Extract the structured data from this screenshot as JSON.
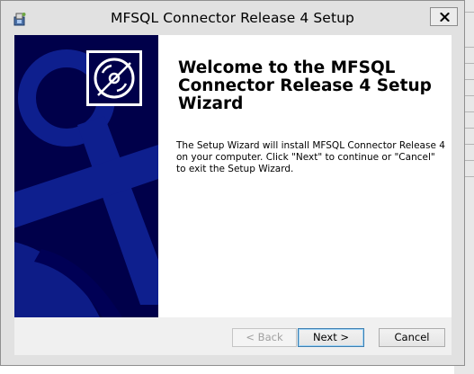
{
  "window": {
    "title": "MFSQL Connector Release 4 Setup",
    "close_symbol": "×",
    "app_icon": "installer-icon"
  },
  "banner": {
    "logo_icon": "cd-disc-icon"
  },
  "welcome": {
    "heading": "Welcome to the MFSQL Connector Release 4 Setup Wizard",
    "description": "The Setup Wizard will install MFSQL Connector Release 4 on your computer.  Click \"Next\" to continue or \"Cancel\" to exit the Setup Wizard."
  },
  "footer": {
    "back_label": "< Back",
    "next_label": "Next >",
    "cancel_label": "Cancel"
  },
  "colors": {
    "banner_background": "#00004a",
    "banner_shape": "#0e1f8e",
    "default_button_border": "#3c7fb1"
  }
}
